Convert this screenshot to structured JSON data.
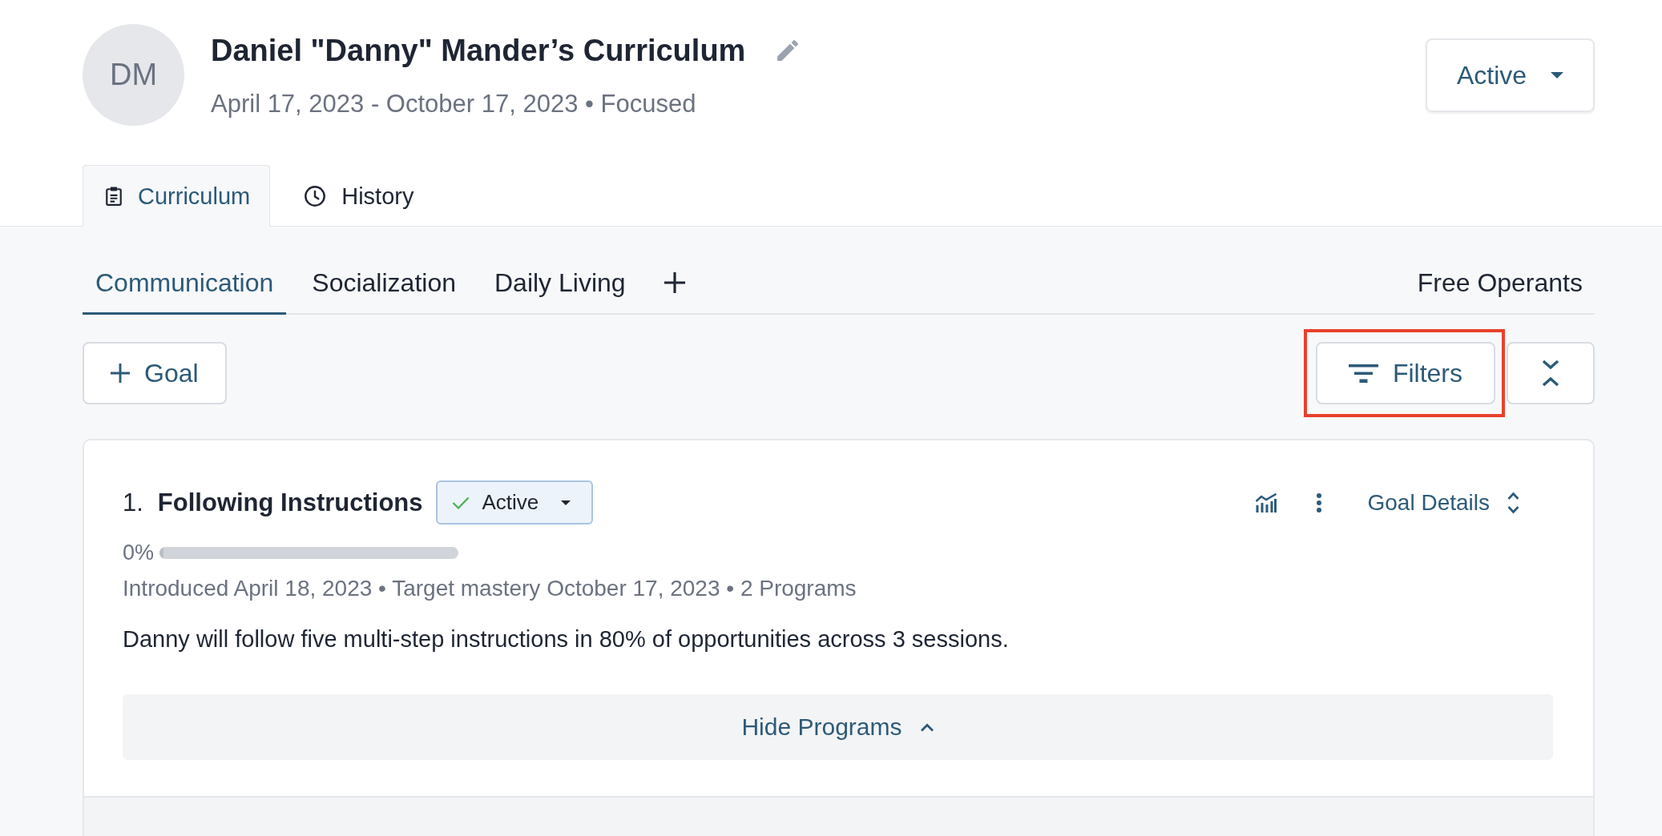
{
  "header": {
    "avatar": "DM",
    "title": "Daniel \"Danny\" Mander’s Curriculum",
    "subtitle": "April 17, 2023 - October 17, 2023 • Focused",
    "status": "Active"
  },
  "tabs": [
    {
      "label": "Curriculum",
      "selected": true
    },
    {
      "label": "History",
      "selected": false
    }
  ],
  "domains": [
    {
      "label": "Communication",
      "selected": true
    },
    {
      "label": "Socialization",
      "selected": false
    },
    {
      "label": "Daily Living",
      "selected": false
    }
  ],
  "free_operants": "Free Operants",
  "toolbar": {
    "add_goal": "Goal",
    "filters": {
      "label": "Filters",
      "highlighted": true
    }
  },
  "goals": [
    {
      "number": "1.",
      "title": "Following Instructions",
      "status": "Active",
      "progress": "0%",
      "level": 0,
      "meta": "Introduced April 18, 2023 • Target mastery October 17, 2023 • 2 Programs",
      "description": "Danny will follow five multi-step instructions in 80% of opportunities across 3 sessions.",
      "details": "Goal Details",
      "programs_toggle": "Hide Programs",
      "programs_expanded": true
    }
  ]
}
